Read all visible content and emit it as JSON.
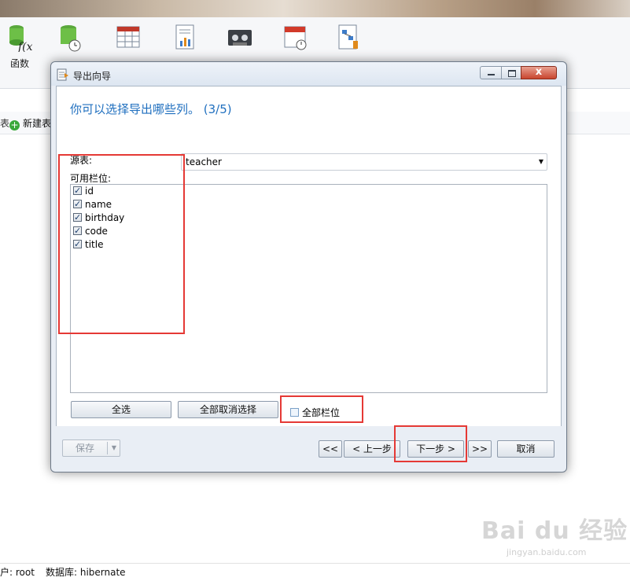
{
  "background_app": {
    "toolbar": [
      {
        "label": "函数",
        "icon": "function-icon"
      },
      {
        "label": "",
        "icon": "event-database-icon"
      },
      {
        "label": "",
        "icon": "table-grid-icon"
      },
      {
        "label": "",
        "icon": "report-icon"
      },
      {
        "label": "",
        "icon": "backup-tape-icon"
      },
      {
        "label": "",
        "icon": "schedule-calendar-icon"
      },
      {
        "label": "",
        "icon": "model-icon"
      }
    ],
    "new_table": "新建表",
    "left_cut_text": "表",
    "status": {
      "user": "户: root",
      "database": "数据库: hibernate"
    },
    "watermark": {
      "main": "Bai du 经验",
      "sub": "jingyan.baidu.com"
    }
  },
  "dialog": {
    "title": "导出向导",
    "close_glyph": "x",
    "heading": "你可以选择导出哪些列。 (3/5)",
    "source_label": "源表:",
    "source_value": "teacher",
    "available_label": "可用栏位:",
    "columns": [
      {
        "name": "id",
        "checked": true
      },
      {
        "name": "name",
        "checked": true
      },
      {
        "name": "birthday",
        "checked": true
      },
      {
        "name": "code",
        "checked": true
      },
      {
        "name": "title",
        "checked": true
      }
    ],
    "select_all": "全选",
    "deselect_all": "全部取消选择",
    "all_columns_label": "全部栏位",
    "all_columns_checked": false,
    "footer": {
      "save": "保存",
      "first": "<<",
      "prev": "< 上一步",
      "next": "下一步 >",
      "last": ">>",
      "cancel": "取消"
    }
  },
  "colors": {
    "heading": "#1f6fbf",
    "annotation": "#e53935"
  }
}
